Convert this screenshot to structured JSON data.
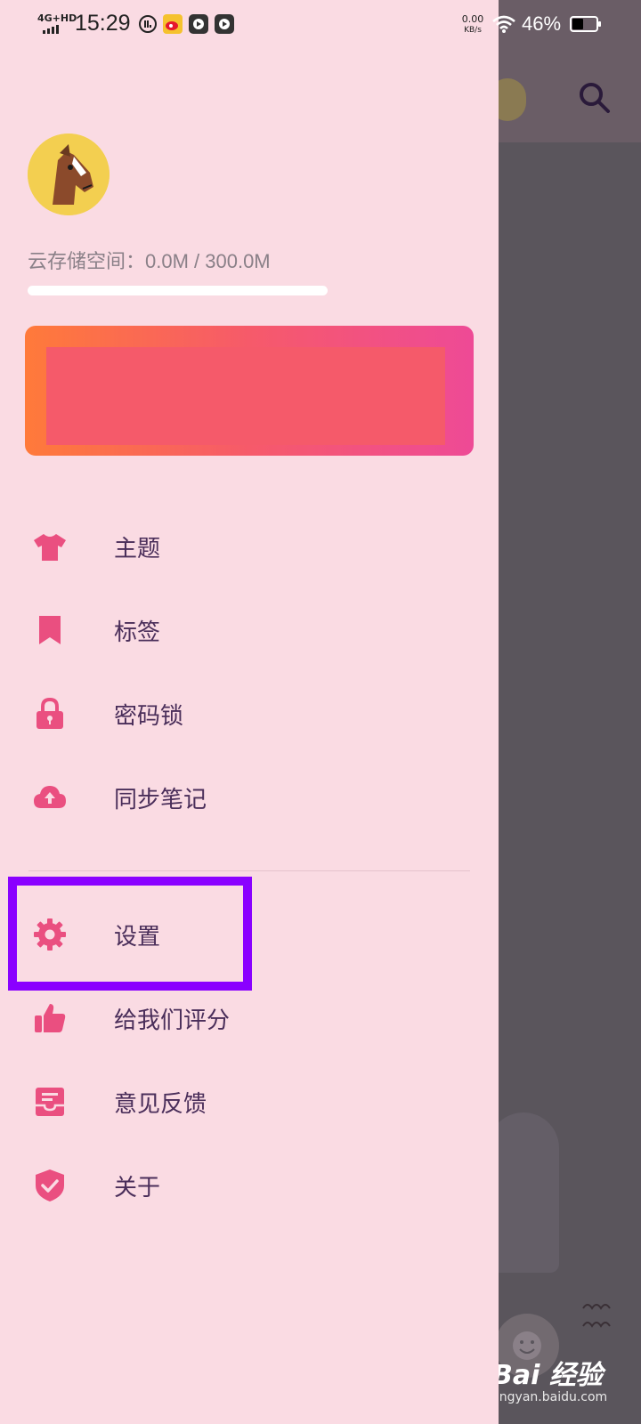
{
  "status_bar": {
    "time": "15:29",
    "network": "4G+HD",
    "speed_value": "0.00",
    "speed_unit": "KB/s",
    "battery": "46%"
  },
  "drawer": {
    "storage_label": "云存储空间：0.0M / 300.0M",
    "storage_used_fraction": 0.0,
    "menu": [
      {
        "label": "主题",
        "icon": "tshirt-icon"
      },
      {
        "label": "标签",
        "icon": "bookmark-icon"
      },
      {
        "label": "密码锁",
        "icon": "lock-icon"
      },
      {
        "label": "同步笔记",
        "icon": "cloud-upload-icon"
      },
      {
        "label": "设置",
        "icon": "gear-icon"
      },
      {
        "label": "给我们评分",
        "icon": "thumbs-up-icon"
      },
      {
        "label": "意见反馈",
        "icon": "feedback-inbox-icon"
      },
      {
        "label": "关于",
        "icon": "shield-check-icon"
      }
    ]
  },
  "watermark": {
    "brand": "Bai 经验",
    "url": "jingyan.baidu.com"
  },
  "colors": {
    "drawer_bg": "#fadbe3",
    "icon_pink": "#ea4f80",
    "label_text": "#4a2e5a",
    "highlight": "#8a00ff"
  }
}
